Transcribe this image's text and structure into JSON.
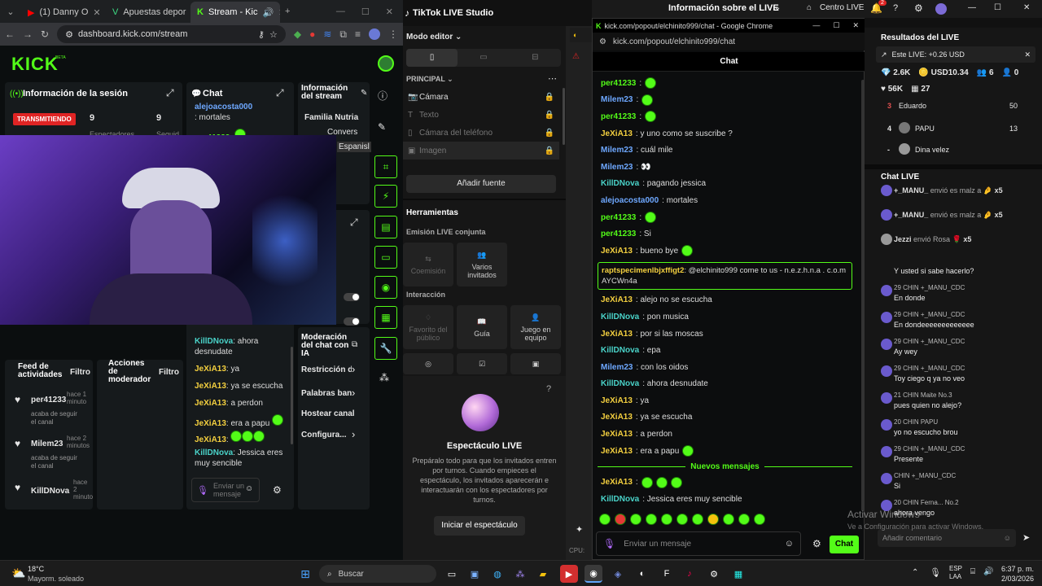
{
  "browser": {
    "tabs": [
      {
        "label": "(1) Danny O"
      },
      {
        "label": "Apuestas depor"
      },
      {
        "label": "Stream - Kic"
      }
    ],
    "url": "dashboard.kick.com/stream"
  },
  "kick": {
    "logo": "KICK",
    "logo_beta": "BETA",
    "session_title": "Información de la sesión",
    "status": "TRANSMITIENDO",
    "viewers_value": "9",
    "followers_value": "9",
    "viewers_label": "Espectadores",
    "followers_label": "Seguid",
    "chat_title": "Chat",
    "chat_messages": [
      {
        "user": "alejoacosta000",
        "text": ": mortales"
      },
      {
        "user": "per41233",
        "text": ":"
      },
      {
        "user": "KillDNova",
        "text": ": ahora desnudate"
      },
      {
        "user": "JeXiA13",
        "text": ": ya"
      },
      {
        "user": "JeXiA13",
        "text": ": ya se escucha"
      },
      {
        "user": "JeXiA13",
        "text": ": a perdon"
      },
      {
        "user": "JeXiA13",
        "text": ": era a papu"
      },
      {
        "user": "JeXiA13",
        "text": ":"
      },
      {
        "user": "KillDNova",
        "text": ": Jessica eres muy sencible"
      }
    ],
    "send_placeholder": "Enviar un mensaje",
    "stream_info_title": "Información del stream",
    "stream_info_name": "Familia Nutria",
    "stream_info_lines": [
      "Convers",
      "Espanisl"
    ],
    "feed_title": "Feed de actividades",
    "feed_filter": "Filtro",
    "feed_items": [
      {
        "user": "per41233",
        "time": "hace 1 minuto",
        "action": "acaba de seguir el canal"
      },
      {
        "user": "Milem23",
        "time": "hace 2 minutos",
        "action": "acaba de seguir el canal"
      },
      {
        "user": "KillDNova",
        "time": "hace 2 minuto",
        "action": ""
      }
    ],
    "mod_actions_title": "Acciones de moderador",
    "mod_filter": "Filtro",
    "mod_menu": [
      "Moderación del chat con IA",
      "Restricción de",
      "Palabras ban",
      "Hostear canal",
      "Configura..."
    ]
  },
  "tiktok": {
    "title": "TikTok LIVE Studio",
    "mode": "Modo editor",
    "section": "PRINCIPAL",
    "sources": [
      {
        "label": "Cámara",
        "dim": false
      },
      {
        "label": "Texto",
        "dim": true
      },
      {
        "label": "Cámara del teléfono",
        "dim": true
      },
      {
        "label": "Imagen",
        "dim": true
      }
    ],
    "add_source": "Añadir fuente",
    "tools_title": "Herramientas",
    "coemission_title": "Emisión LIVE conjunta",
    "coemission_buttons": [
      "Coemisión",
      "Varios invitados"
    ],
    "interaction_title": "Interacción",
    "interaction_buttons": [
      "Favorito del público",
      "Guía",
      "Juego en equipo"
    ],
    "show_title": "Espectáculo LIVE",
    "show_desc": "Prepáralo todo para que los invitados entren por turnos. Cuando empieces el espectáculo, los invitados aparecerán e interactuarán con los espectadores por turnos.",
    "show_button": "Iniciar el espectáculo",
    "cpu_label": "CPU:"
  },
  "popout": {
    "window_title": "kick.com/popout/elchinito999/chat - Google Chrome",
    "url": "kick.com/popout/elchinito999/chat",
    "header": "Chat",
    "messages": [
      {
        "user": "per41233",
        "text": ":",
        "color": "g",
        "emotes": 1
      },
      {
        "user": "Milem23",
        "text": ":",
        "color": "b",
        "emotes": 1
      },
      {
        "user": "per41233",
        "text": ":",
        "color": "g",
        "emotes": 1
      },
      {
        "user": "JeXiA13",
        "text": ": y uno como se suscribe ?",
        "color": "y",
        "emotes": 0
      },
      {
        "user": "Milem23",
        "text": ": cuál mile",
        "color": "b",
        "emotes": 0
      },
      {
        "user": "Milem23",
        "text": ": 👀",
        "color": "b",
        "emotes": 0
      },
      {
        "user": "KillDNova",
        "text": ": pagando jessica",
        "color": "t",
        "emotes": 0
      },
      {
        "user": "alejoacosta000",
        "text": ": mortales",
        "color": "b",
        "emotes": 0
      },
      {
        "user": "per41233",
        "text": ":",
        "color": "g",
        "emotes": 1
      },
      {
        "user": "per41233",
        "text": ": Si",
        "color": "g",
        "emotes": 0
      },
      {
        "user": "JeXiA13",
        "text": ": bueno bye",
        "color": "y",
        "emotes": 1
      }
    ],
    "highlight_user": "raptspecimenlbjxffigt2",
    "highlight_text": ": @elchinito999 come to us - n.e.z.h.n.a . c.o.m AYCWn4a",
    "messages2": [
      {
        "user": "JeXiA13",
        "text": ": alejo no se escucha",
        "color": "y",
        "emotes": 0
      },
      {
        "user": "KillDNova",
        "text": ": pon musica",
        "color": "t",
        "emotes": 0
      },
      {
        "user": "JeXiA13",
        "text": ": por si las moscas",
        "color": "y",
        "emotes": 0
      },
      {
        "user": "KillDNova",
        "text": ": epa",
        "color": "t",
        "emotes": 0
      },
      {
        "user": "Milem23",
        "text": ": con los oidos",
        "color": "b",
        "emotes": 0
      },
      {
        "user": "KillDNova",
        "text": ": ahora desnudate",
        "color": "t",
        "emotes": 0
      },
      {
        "user": "JeXiA13",
        "text": ": ya",
        "color": "y",
        "emotes": 0
      },
      {
        "user": "JeXiA13",
        "text": ": ya se escucha",
        "color": "y",
        "emotes": 0
      },
      {
        "user": "JeXiA13",
        "text": ": a perdon",
        "color": "y",
        "emotes": 0
      },
      {
        "user": "JeXiA13",
        "text": ": era a papu",
        "color": "y",
        "emotes": 1
      }
    ],
    "new_messages": "Nuevos mensajes",
    "messages3": [
      {
        "user": "JeXiA13",
        "text": ":",
        "color": "y",
        "emotes": 3
      },
      {
        "user": "KillDNova",
        "text": ": Jessica eres muy sencible",
        "color": "t",
        "emotes": 0
      }
    ],
    "input_placeholder": "Enviar un mensaje",
    "send_button": "Chat"
  },
  "tiktok_right": {
    "top_title": "Información sobre el LIVE",
    "center": "Centro LIVE",
    "notif_count": "2",
    "results_title": "Resultados del LIVE",
    "this_live": "Este LIVE: +0.26 USD",
    "stats": [
      "2.6K",
      "USD10.34",
      "6",
      "0",
      "56K",
      "27"
    ],
    "ranking": [
      {
        "rank": "3",
        "name": "Eduardo",
        "score": "50"
      },
      {
        "rank": "4",
        "name": "PAPU",
        "score": "13"
      },
      {
        "rank": "-",
        "name": "Dina velez",
        "score": ""
      }
    ],
    "chat_title": "Chat LIVE",
    "gifts": [
      {
        "user": "+_MANU_",
        "text": "envió es malz a",
        "mult": "x5"
      },
      {
        "user": "+_MANU_",
        "text": "envió es malz a",
        "mult": "x5"
      },
      {
        "user": "Jezzi",
        "text": "envió Rosa",
        "mult": "x5"
      }
    ],
    "comments": [
      {
        "user": "",
        "text": "Y usted si sabe hacerlo?"
      },
      {
        "user": "29 CHIN +_MANU_CDC",
        "text": "En donde"
      },
      {
        "user": "29 CHIN +_MANU_CDC",
        "text": "En dondeeeeeeeeeeeee"
      },
      {
        "user": "29 CHIN +_MANU_CDC",
        "text": "Ay wey"
      },
      {
        "user": "29 CHIN +_MANU_CDC",
        "text": "Toy ciego q ya no veo"
      },
      {
        "user": "21 CHIN Maite No.3",
        "text": "pues quien no alejo?"
      },
      {
        "user": "20 CHIN PAPU",
        "text": "yo no escucho brou"
      },
      {
        "user": "29 CHIN +_MANU_CDC",
        "text": "Presente"
      },
      {
        "user": "CHIN +_MANU_CDC",
        "text": "Si"
      },
      {
        "user": "20 CHIN Ferna... No.2",
        "text": "ahora vengo"
      }
    ],
    "add_comment": "Añadir comentario"
  },
  "windows": {
    "activate_title": "Activar Windows",
    "activate_sub": "Ve a Configuración para activar Windows."
  },
  "taskbar": {
    "weather_temp": "18°C",
    "weather_desc": "Mayorm. soleado",
    "search": "Buscar",
    "lang1": "ESP",
    "lang2": "LAA",
    "time": "6:37 p. m.",
    "date": "2/03/2026"
  },
  "colors": {
    "kick_green": "#53fc18",
    "status_red": "#e02424",
    "tiktok_accent": "#25f4ee"
  }
}
